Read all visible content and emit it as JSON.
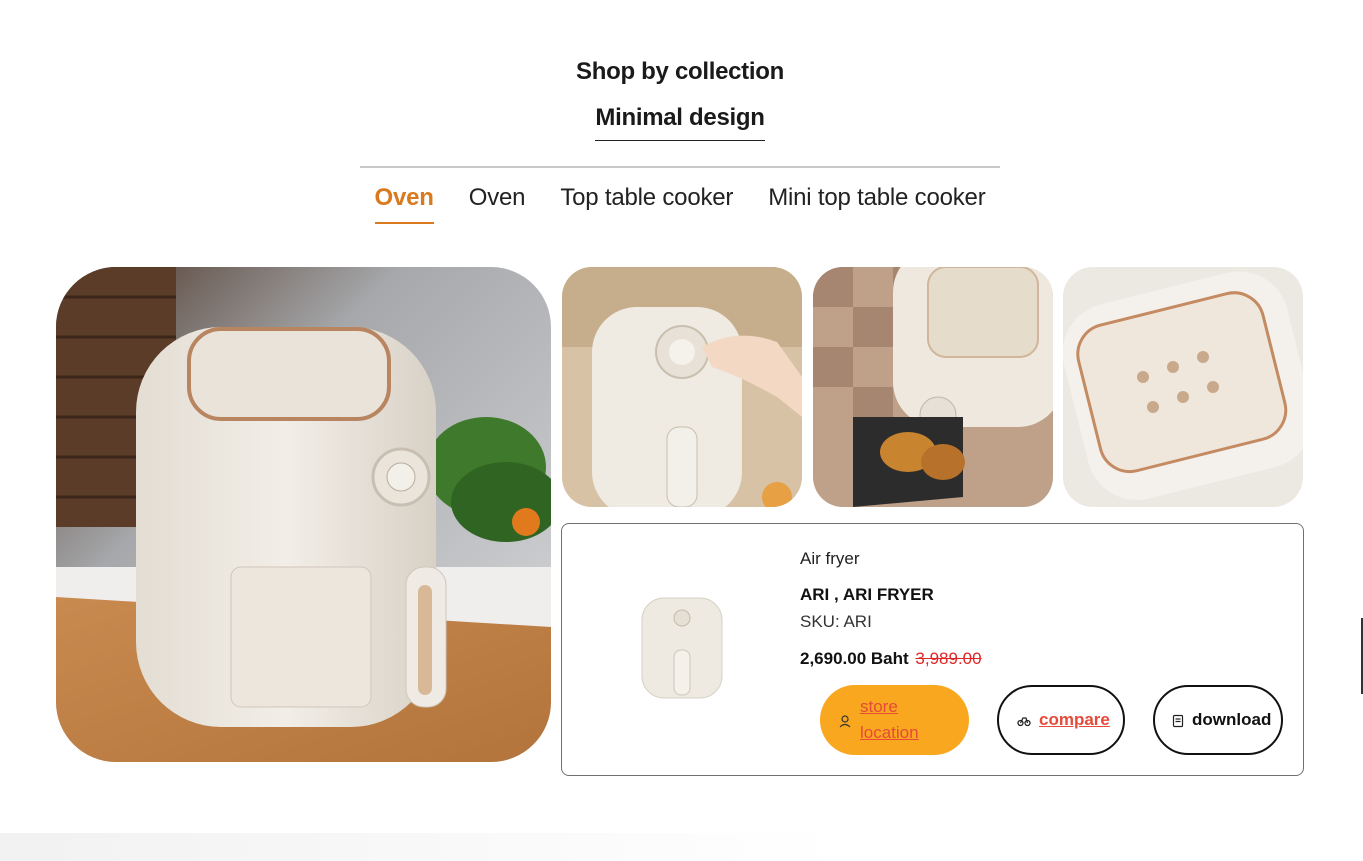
{
  "header": {
    "title": "Shop by collection",
    "collection": "Minimal design"
  },
  "tabs": [
    {
      "label": "Oven",
      "active": true
    },
    {
      "label": "Oven",
      "active": false
    },
    {
      "label": "Top table cooker",
      "active": false
    },
    {
      "label": "Mini top table cooker",
      "active": false
    }
  ],
  "product": {
    "category": "Air fryer",
    "name": "ARI , ARI FRYER",
    "sku": "SKU: ARI",
    "price": "2,690.00 Baht",
    "old_price": "3,989.00"
  },
  "buttons": {
    "store": "store location",
    "compare": "compare",
    "download": "download"
  },
  "colors": {
    "accent": "#d97a1e",
    "store_button": "#f8a71f",
    "link_red": "#e64a3a",
    "old_price": "#e12525"
  }
}
